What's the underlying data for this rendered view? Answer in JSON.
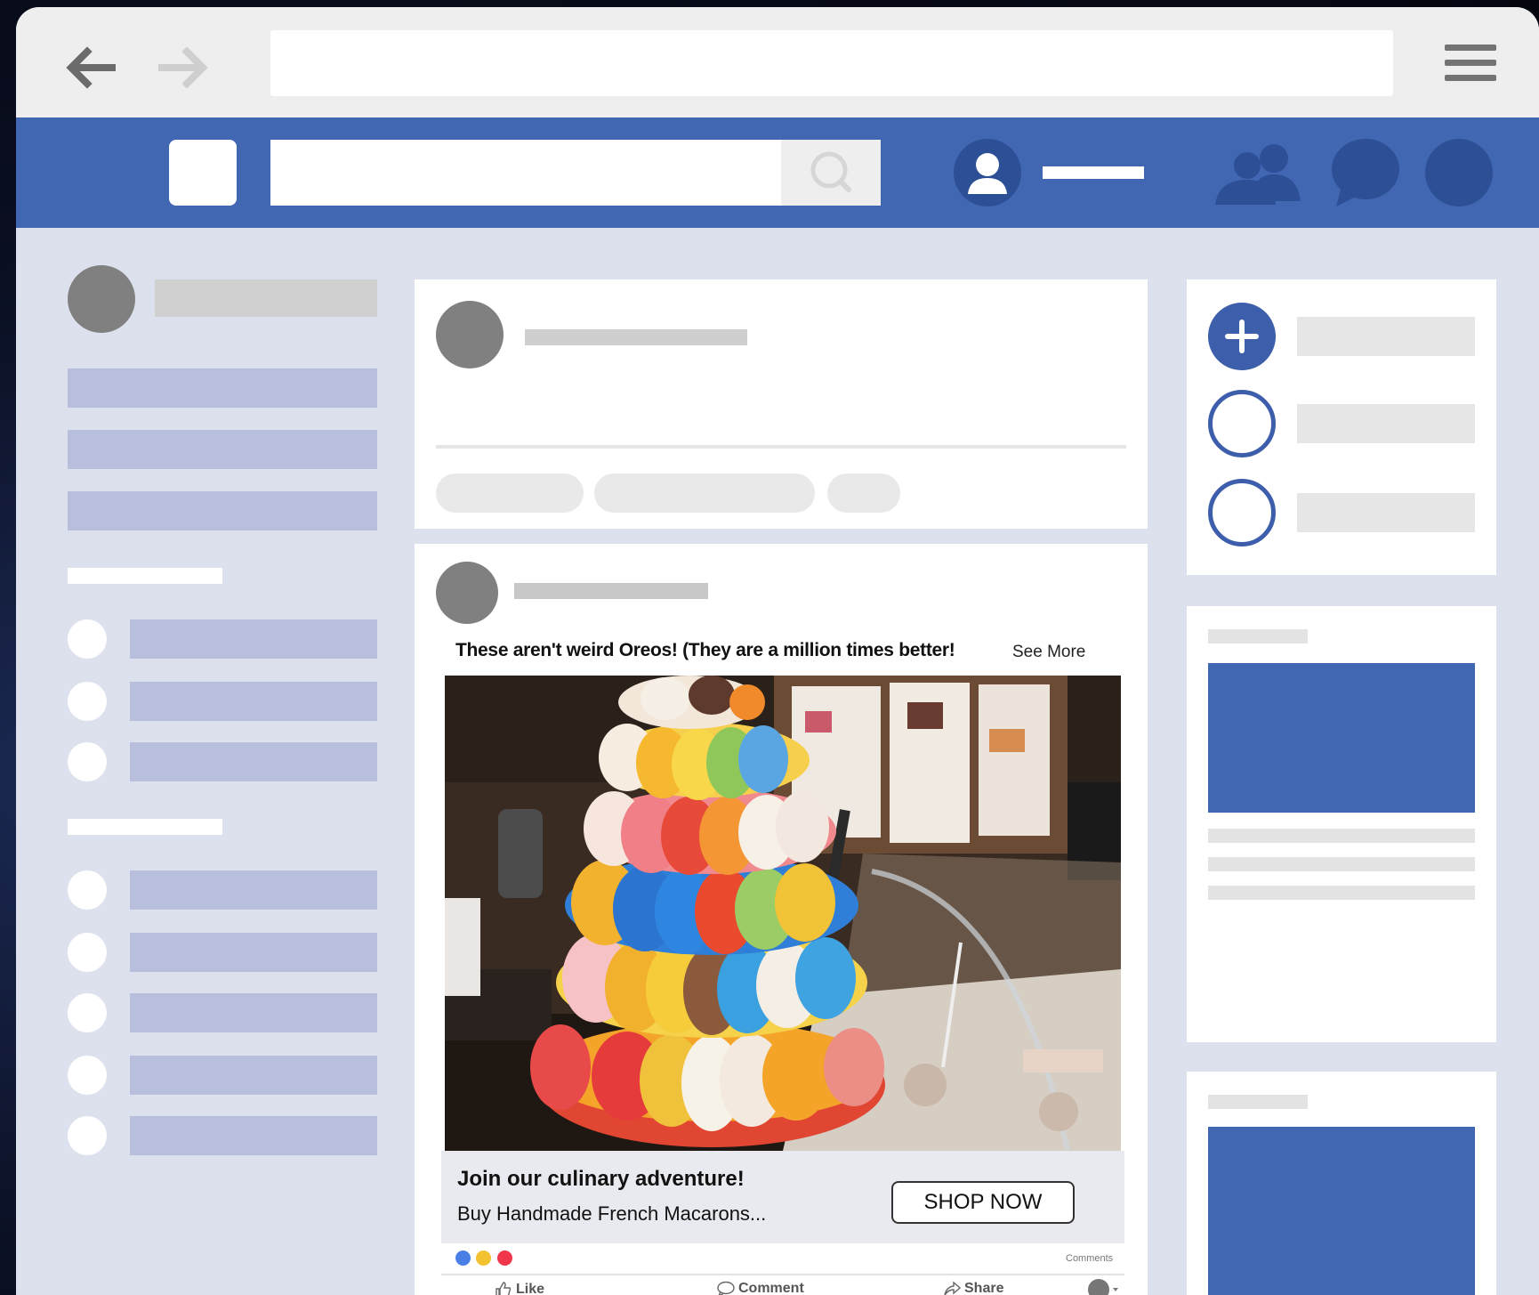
{
  "browser": {
    "back_icon": "arrow-left-icon",
    "forward_icon": "arrow-right-icon",
    "menu_icon": "hamburger-menu-icon",
    "url": ""
  },
  "navbar": {
    "color": "#4267b2",
    "search_placeholder": "",
    "icons": [
      "search-icon",
      "profile-icon",
      "friends-icon",
      "messenger-icon",
      "notifications-icon"
    ]
  },
  "post": {
    "caption": "These aren't weird Oreos! (They are a million times better!",
    "see_more": "See More",
    "ad_title": "Join our culinary adventure!",
    "ad_subtitle": "Buy Handmade French Macarons...",
    "cta_label": "SHOP NOW",
    "comments_label": "Comments",
    "actions": {
      "like": "Like",
      "comment": "Comment",
      "share": "Share"
    },
    "reaction_colors": [
      "#4a7fe5",
      "#f2c230",
      "#f0364a"
    ]
  },
  "right_column": {
    "add_icon": "plus-icon",
    "accent": "#3d5eab"
  }
}
